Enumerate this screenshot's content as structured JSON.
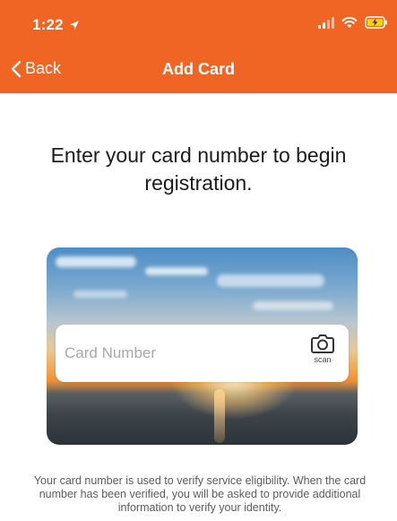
{
  "status_bar": {
    "time": "1:22",
    "icons": [
      "location-arrow-icon",
      "cellular-signal-icon",
      "wifi-icon",
      "battery-charging-icon"
    ]
  },
  "nav": {
    "back_label": "Back",
    "back_icon": "chevron-left-icon",
    "title": "Add Card"
  },
  "main": {
    "prompt": "Enter your card number to begin registration.",
    "card_input": {
      "placeholder": "Card Number",
      "value": ""
    },
    "scan": {
      "icon": "camera-icon",
      "label": "scan"
    },
    "info_text": "Your card number is used to verify service eligibility. When the card number has been verified, you will be asked to provide additional information to verify your identity."
  },
  "colors": {
    "header_background": "#f06424",
    "header_text": "#ffffff",
    "body_text": "#1c1c1c",
    "info_text": "#5c5c5c"
  }
}
